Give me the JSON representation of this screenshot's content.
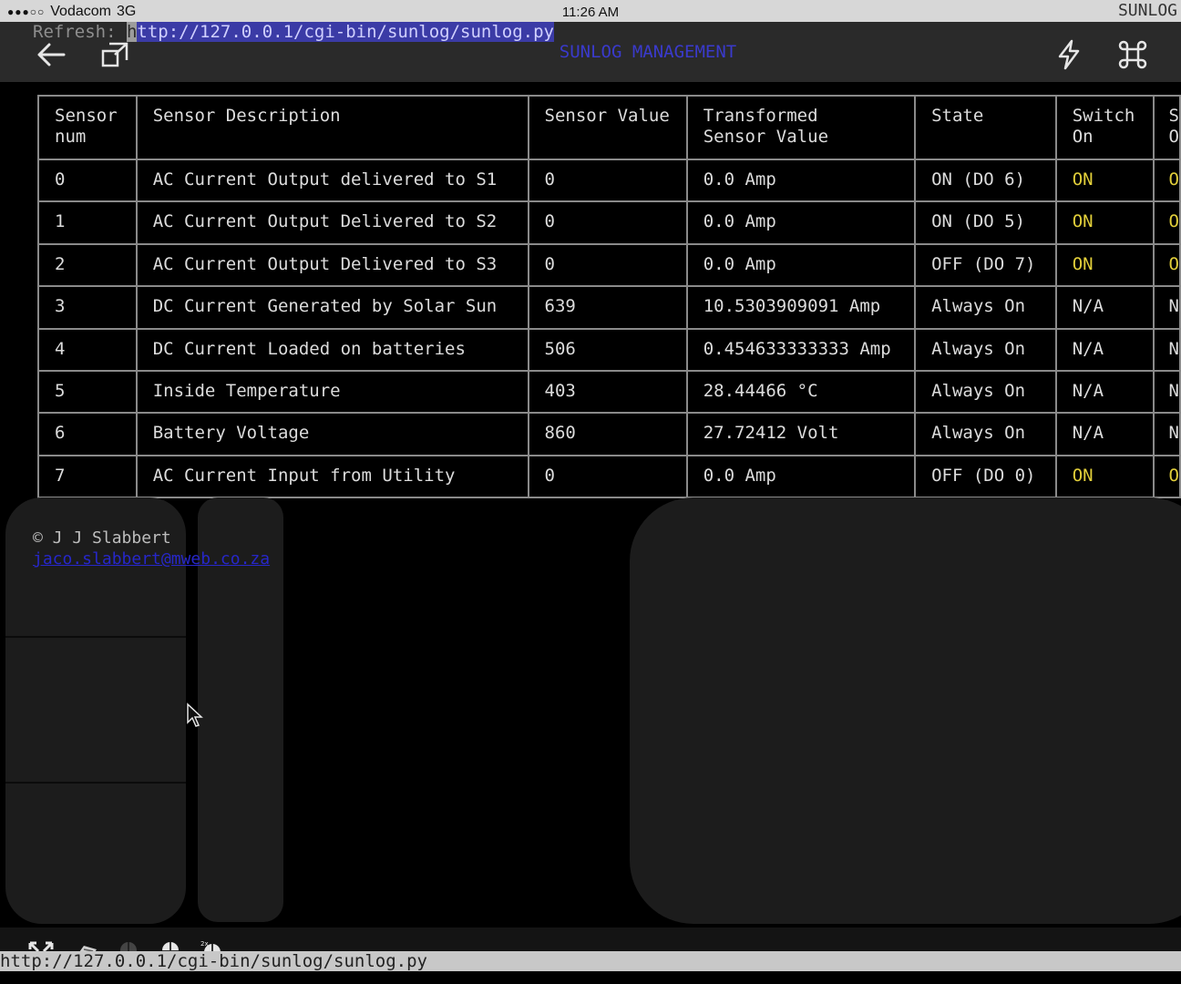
{
  "status_bar": {
    "signal": "●●●○○",
    "carrier": "Vodacom",
    "network": "3G",
    "time": "11:26 AM",
    "app_title": "SUNLOG"
  },
  "toolbar": {
    "refresh_label": "Refresh:",
    "refresh_url_first_char": "h",
    "refresh_url_rest": "ttp://127.0.0.1/cgi-bin/sunlog/sunlog.py",
    "page_heading": "SUNLOG MANAGEMENT",
    "icons": [
      "back-arrow-icon",
      "resize-icon",
      "lightning-icon",
      "command-icon"
    ]
  },
  "table": {
    "headers": [
      "Sensor num",
      "Sensor Description",
      "Sensor Value",
      "Transformed Sensor Value",
      "State",
      "Switch On",
      "S O"
    ],
    "header_lines": [
      [
        "Sensor",
        "num"
      ],
      [
        "Sensor Description",
        ""
      ],
      [
        "Sensor Value",
        ""
      ],
      [
        "Transformed",
        "Sensor Value"
      ],
      [
        "State",
        ""
      ],
      [
        "Switch",
        "On"
      ],
      [
        "S",
        "O"
      ]
    ],
    "rows": [
      {
        "num": "0",
        "description": "AC Current Output delivered to S1",
        "value": "0",
        "transformed": "0.0 Amp",
        "state": "ON (DO 6)",
        "switch_on": "ON",
        "next": "O"
      },
      {
        "num": "1",
        "description": "AC Current Output Delivered to S2",
        "value": "0",
        "transformed": "0.0 Amp",
        "state": "ON (DO 5)",
        "switch_on": "ON",
        "next": "O"
      },
      {
        "num": "2",
        "description": "AC Current Output Delivered to S3",
        "value": "0",
        "transformed": "0.0 Amp",
        "state": "OFF (DO 7)",
        "switch_on": "ON",
        "next": "O"
      },
      {
        "num": "3",
        "description": "DC Current Generated by Solar Sun",
        "value": "639",
        "transformed": "10.5303909091 Amp",
        "state": "Always On",
        "switch_on": "N/A",
        "next": "N"
      },
      {
        "num": "4",
        "description": "DC Current Loaded on batteries",
        "value": "506",
        "transformed": "0.454633333333 Amp",
        "state": "Always On",
        "switch_on": "N/A",
        "next": "N"
      },
      {
        "num": "5",
        "description": "Inside Temperature",
        "value": "403",
        "transformed": "28.44466 °C",
        "state": "Always On",
        "switch_on": "N/A",
        "next": "N"
      },
      {
        "num": "6",
        "description": "Battery Voltage",
        "value": "860",
        "transformed": "27.72412 Volt",
        "state": "Always On",
        "switch_on": "N/A",
        "next": "N"
      },
      {
        "num": "7",
        "description": "AC Current Input from Utility",
        "value": "0",
        "transformed": "0.0 Amp",
        "state": "OFF (DO 0)",
        "switch_on": "ON",
        "next": "O"
      }
    ]
  },
  "footer": {
    "copyright": "© J J Slabbert",
    "email": "jaco.slabbert@mweb.co.za"
  },
  "bottom_bar": {
    "status_url": "http://127.0.0.1/cgi-bin/sunlog/sunlog.py",
    "icons": [
      "fullscreen-icon",
      "keyboard-icon",
      "mouse-icon",
      "mouse-left-click-icon",
      "mouse-double-click-icon"
    ]
  },
  "colors": {
    "on_state": "#e2cf3a",
    "link": "#2727c9",
    "url_highlight": "#3b3ba6"
  }
}
